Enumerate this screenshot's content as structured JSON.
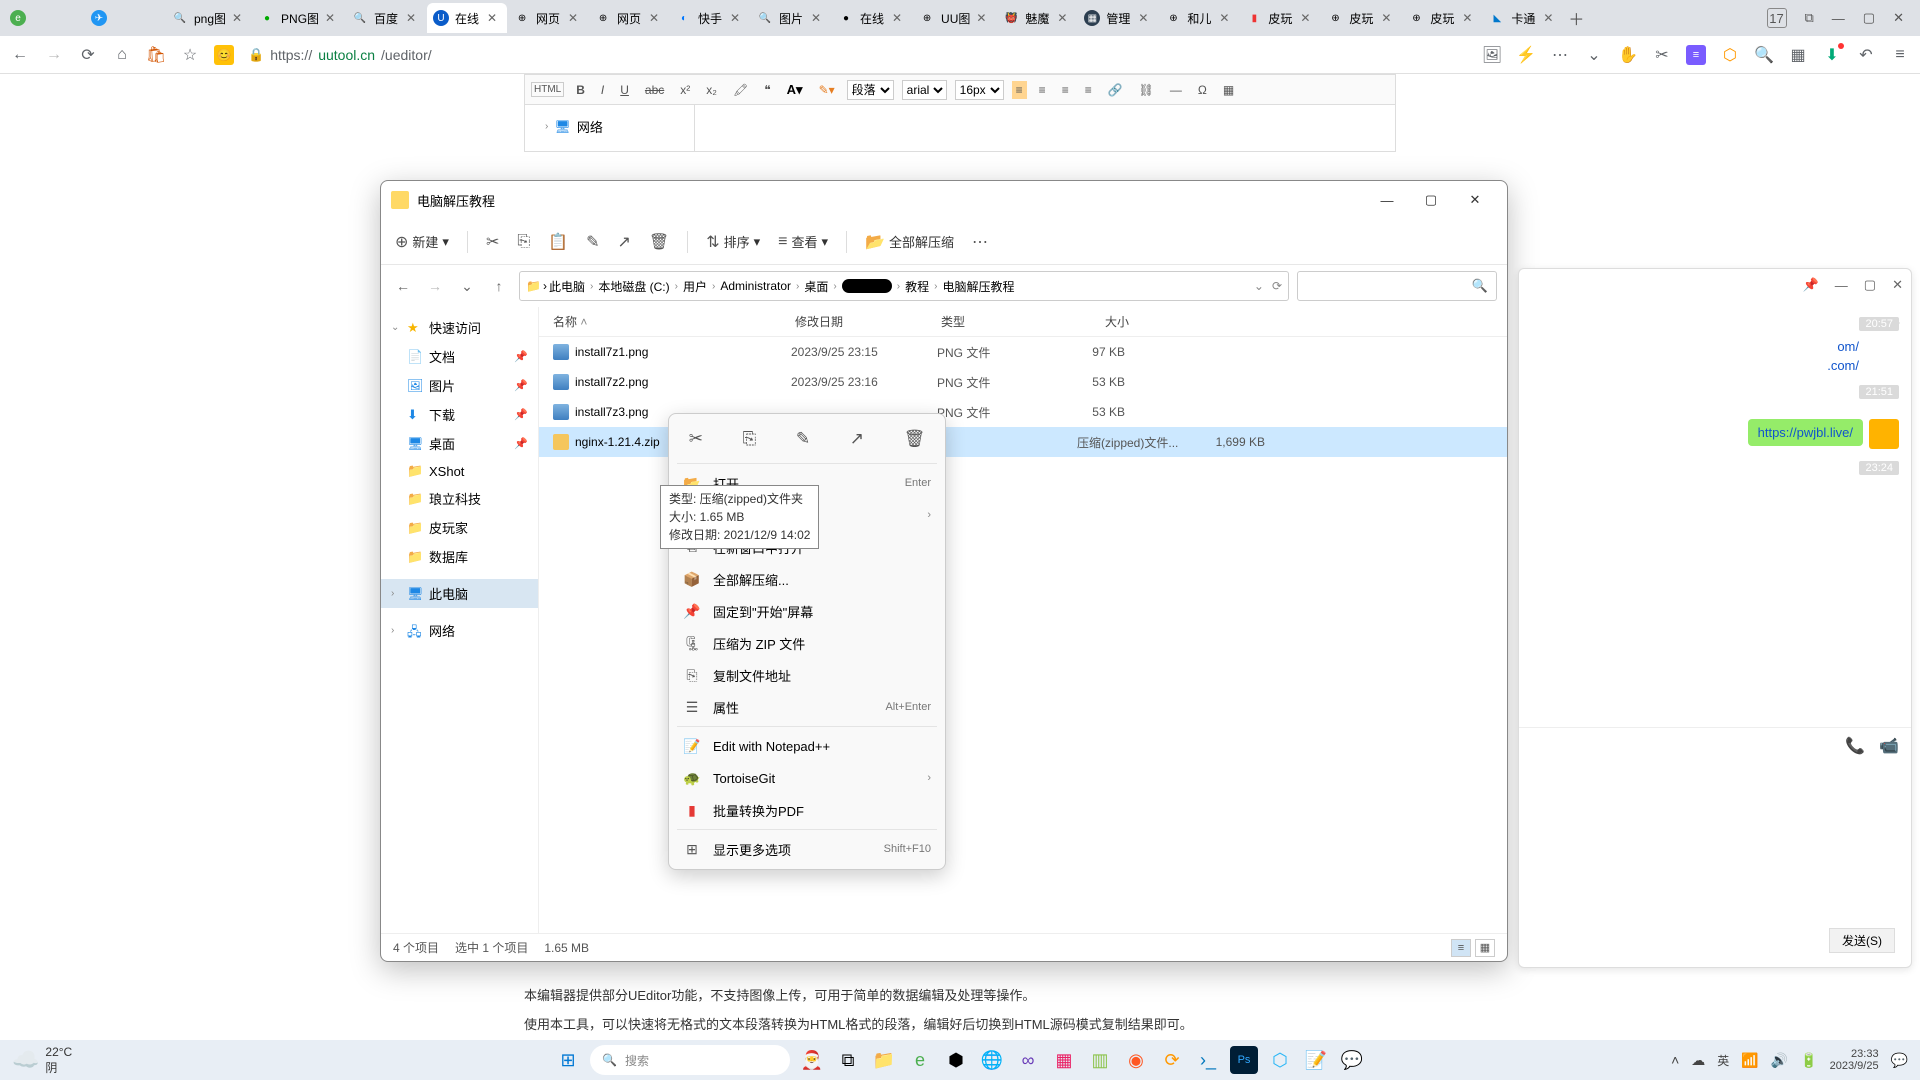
{
  "browser": {
    "tabs": [
      {
        "title": "",
        "fav": "e"
      },
      {
        "title": "",
        "fav": "✈"
      },
      {
        "title": "png图",
        "fav": "🔍"
      },
      {
        "title": "PNG图",
        "fav": "🟢"
      },
      {
        "title": "百度",
        "fav": "🔍"
      },
      {
        "title": "在线",
        "fav": "U",
        "active": true
      },
      {
        "title": "网页",
        "fav": "⊕"
      },
      {
        "title": "网页",
        "fav": "⊕"
      },
      {
        "title": "快手",
        "fav": "◐"
      },
      {
        "title": "图片",
        "fav": "🔍"
      },
      {
        "title": "在线",
        "fav": "●"
      },
      {
        "title": "UU图",
        "fav": "⊕"
      },
      {
        "title": "魅魔",
        "fav": "👹"
      },
      {
        "title": "管理",
        "fav": "▦"
      },
      {
        "title": "和儿",
        "fav": "⊕"
      },
      {
        "title": "皮玩",
        "fav": "▮"
      },
      {
        "title": "皮玩",
        "fav": "⊕"
      },
      {
        "title": "皮玩",
        "fav": "⊕"
      },
      {
        "title": "卡通",
        "fav": "◣"
      }
    ],
    "cal_badge": "17",
    "url": {
      "host": "uutool.cn",
      "path": "/ueditor/"
    }
  },
  "editor": {
    "paragraph": "段落",
    "font": "arial",
    "size": "16px",
    "tree_item": "网络",
    "note1": "本编辑器提供部分UEditor功能，不支持图像上传，可用于简单的数据编辑及处理等操作。",
    "note2": "使用本工具，可以快速将无格式的文本段落转换为HTML格式的段落，编辑好后切换到HTML源码模式复制结果即可。"
  },
  "explorer": {
    "title": "电脑解压教程",
    "cmd": {
      "new": "新建",
      "sort": "排序",
      "view": "查看",
      "extract": "全部解压缩"
    },
    "path": [
      "此电脑",
      "本地磁盘 (C:)",
      "用户",
      "Administrator",
      "桌面",
      "",
      "教程",
      "电脑解压教程"
    ],
    "cols": {
      "name": "名称",
      "date": "修改日期",
      "type": "类型",
      "size": "大小"
    },
    "rows": [
      {
        "name": "install7z1.png",
        "date": "2023/9/25 23:15",
        "type": "PNG 文件",
        "size": "97 KB"
      },
      {
        "name": "install7z2.png",
        "date": "2023/9/25 23:16",
        "type": "PNG 文件",
        "size": "53 KB"
      },
      {
        "name": "install7z3.png",
        "date": "",
        "type": "PNG 文件",
        "size": "53 KB"
      },
      {
        "name": "nginx-1.21.4.zip",
        "date": "",
        "type": "压缩(zipped)文件...",
        "size": "1,699 KB",
        "sel": true
      }
    ],
    "side": {
      "quick": "快速访问",
      "docs": "文档",
      "pics": "图片",
      "down": "下载",
      "desk": "桌面",
      "xshot": "XShot",
      "langli": "琅立科技",
      "piwan": "皮玩家",
      "db": "数据库",
      "thispc": "此电脑",
      "net": "网络"
    },
    "status": {
      "count": "4 个项目",
      "sel": "选中 1 个项目",
      "size": "1.65 MB"
    }
  },
  "ctx": {
    "open": "打开",
    "open_sc": "Enter",
    "newwin": "在新窗口中打开",
    "extract": "全部解压缩...",
    "pin": "固定到\"开始\"屏幕",
    "zip": "压缩为 ZIP 文件",
    "copypath": "复制文件地址",
    "props": "属性",
    "props_sc": "Alt+Enter",
    "npp": "Edit with Notepad++",
    "tortoise": "TortoiseGit",
    "pdf": "批量转换为PDF",
    "more": "显示更多选项",
    "more_sc": "Shift+F10"
  },
  "tooltip": {
    "l1": "类型: 压缩(zipped)文件夹",
    "l2": "大小: 1.65 MB",
    "l3": "修改日期: 2021/12/9 14:02"
  },
  "chat": {
    "t1": "20:57",
    "t2": "21:51",
    "t3": "23:24",
    "link1": "om/",
    "link2": ".com/",
    "msg": "https://pwjbl.live/",
    "send": "发送(S)"
  },
  "taskbar": {
    "temp": "22°C",
    "cond": "阴",
    "search": "搜索",
    "ime": "英",
    "time": "23:33",
    "date": "2023/9/25"
  }
}
